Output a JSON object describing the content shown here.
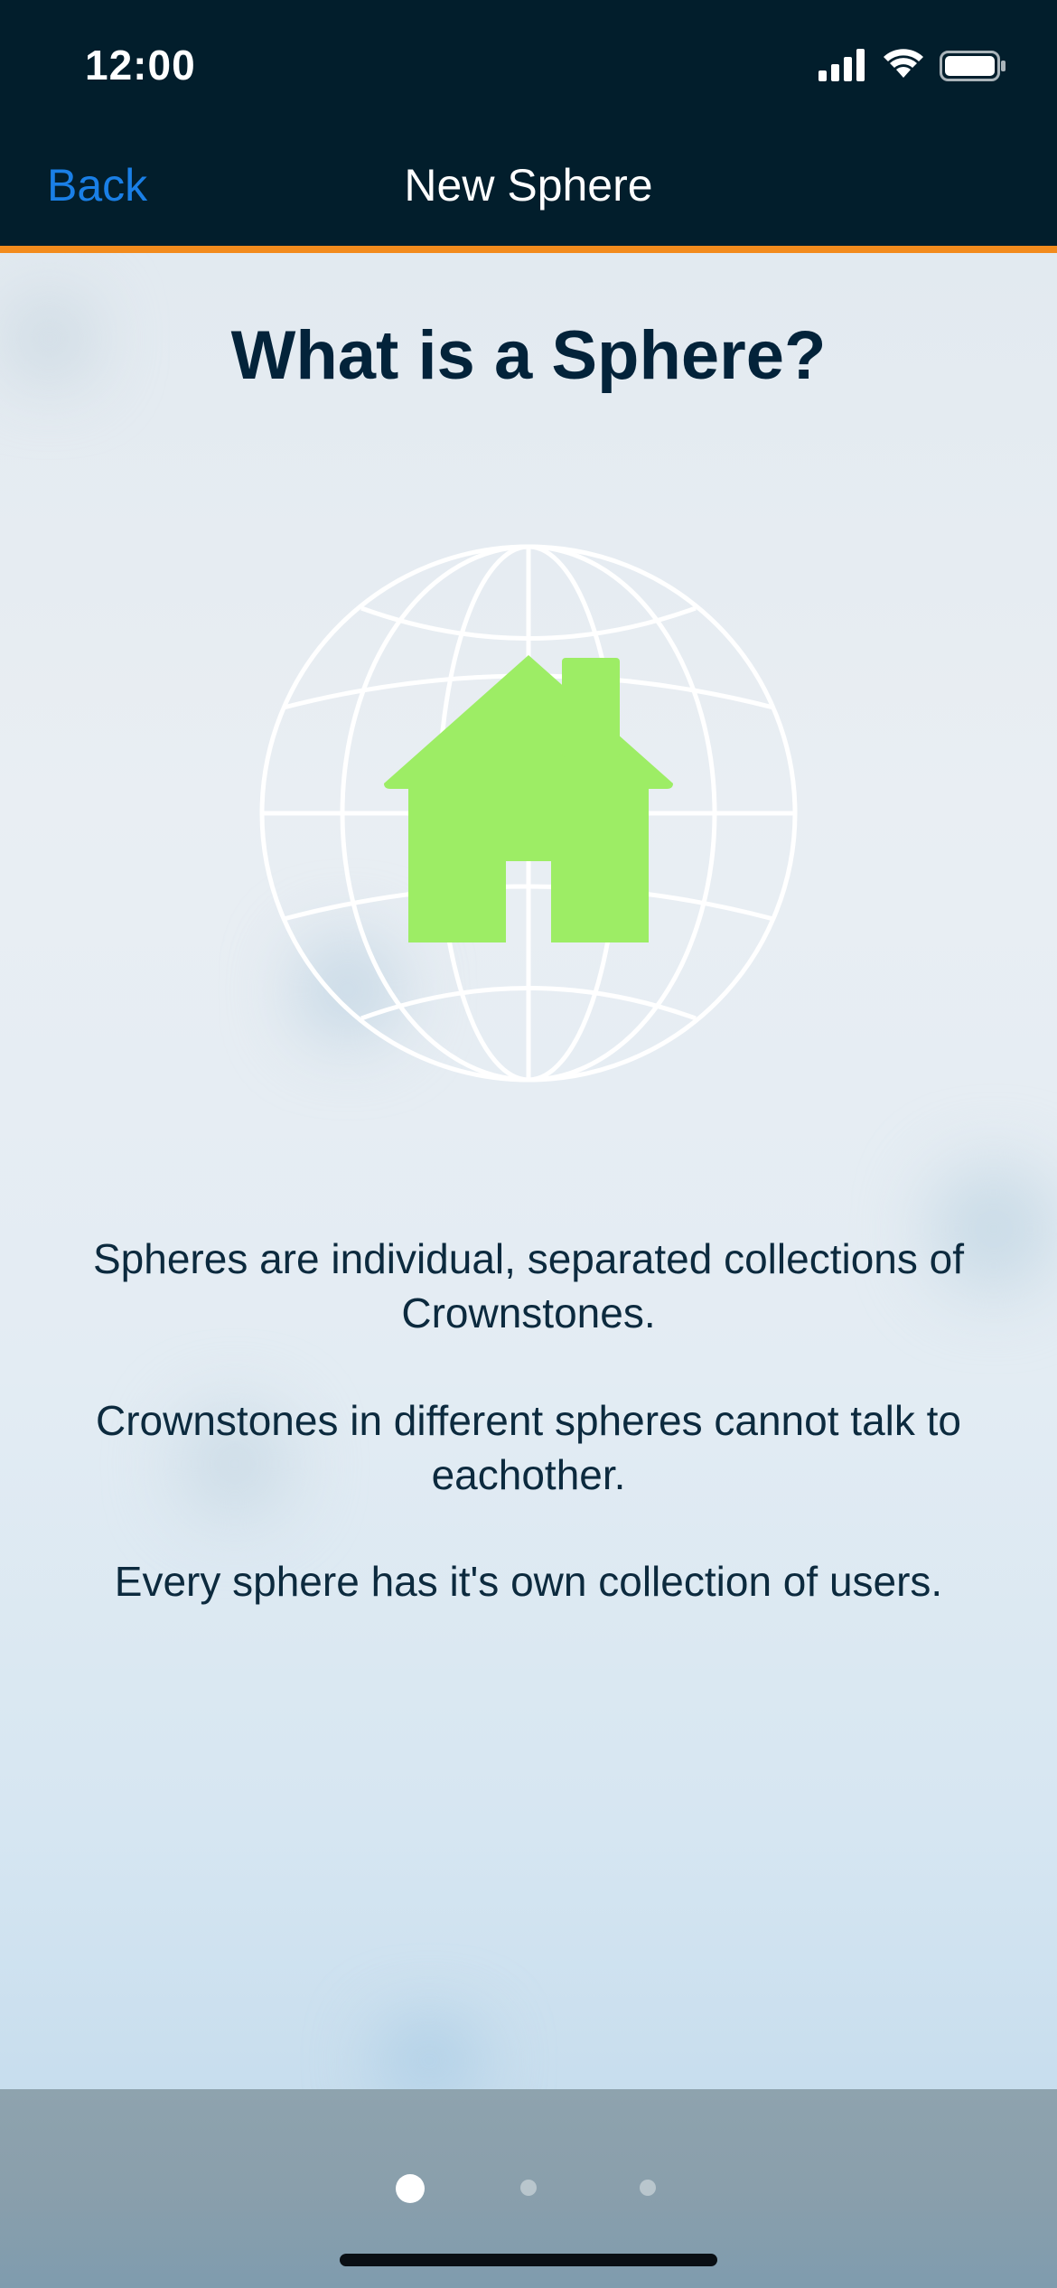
{
  "status_bar": {
    "time": "12:00"
  },
  "nav": {
    "back_label": "Back",
    "title": "New Sphere"
  },
  "content": {
    "heading": "What is a Sphere?",
    "paragraphs": [
      "Spheres are individual, separated collections of Crownstones.",
      "Crownstones in different spheres cannot talk to eachother.",
      "Every sphere has it's own collection of users."
    ]
  },
  "pager": {
    "pages": 3,
    "active_page": 1
  },
  "colors": {
    "nav_background": "#021e2c",
    "accent_line": "#f28b1d",
    "back_link": "#1a7fe6",
    "house_icon": "#9ded65",
    "heading_text": "#03233a"
  },
  "icons": [
    "signal-icon",
    "wifi-icon",
    "battery-icon",
    "globe-icon",
    "house-icon"
  ]
}
